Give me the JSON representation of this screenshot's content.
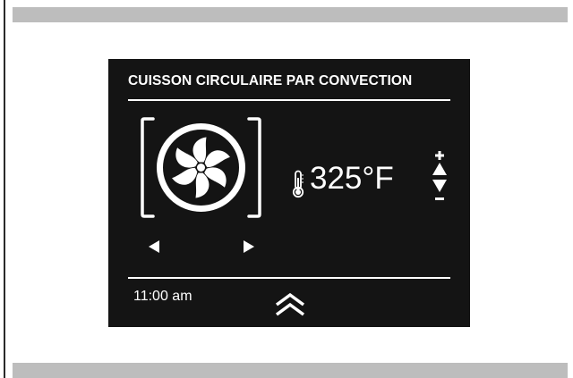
{
  "screen": {
    "title": "CUISSON CIRCULAIRE PAR CONVECTION",
    "temperature": "325°F",
    "time": "11:00 am",
    "background_color": "#141414",
    "foreground_color": "#ffffff"
  },
  "icons": {
    "mode": "convection-fan-icon",
    "prev": "arrow-left-icon",
    "next": "arrow-right-icon",
    "temperature": "thermometer-icon",
    "increase": "plus-up-arrow-icon",
    "decrease": "minus-down-arrow-icon",
    "menu": "chevron-double-up-icon"
  }
}
